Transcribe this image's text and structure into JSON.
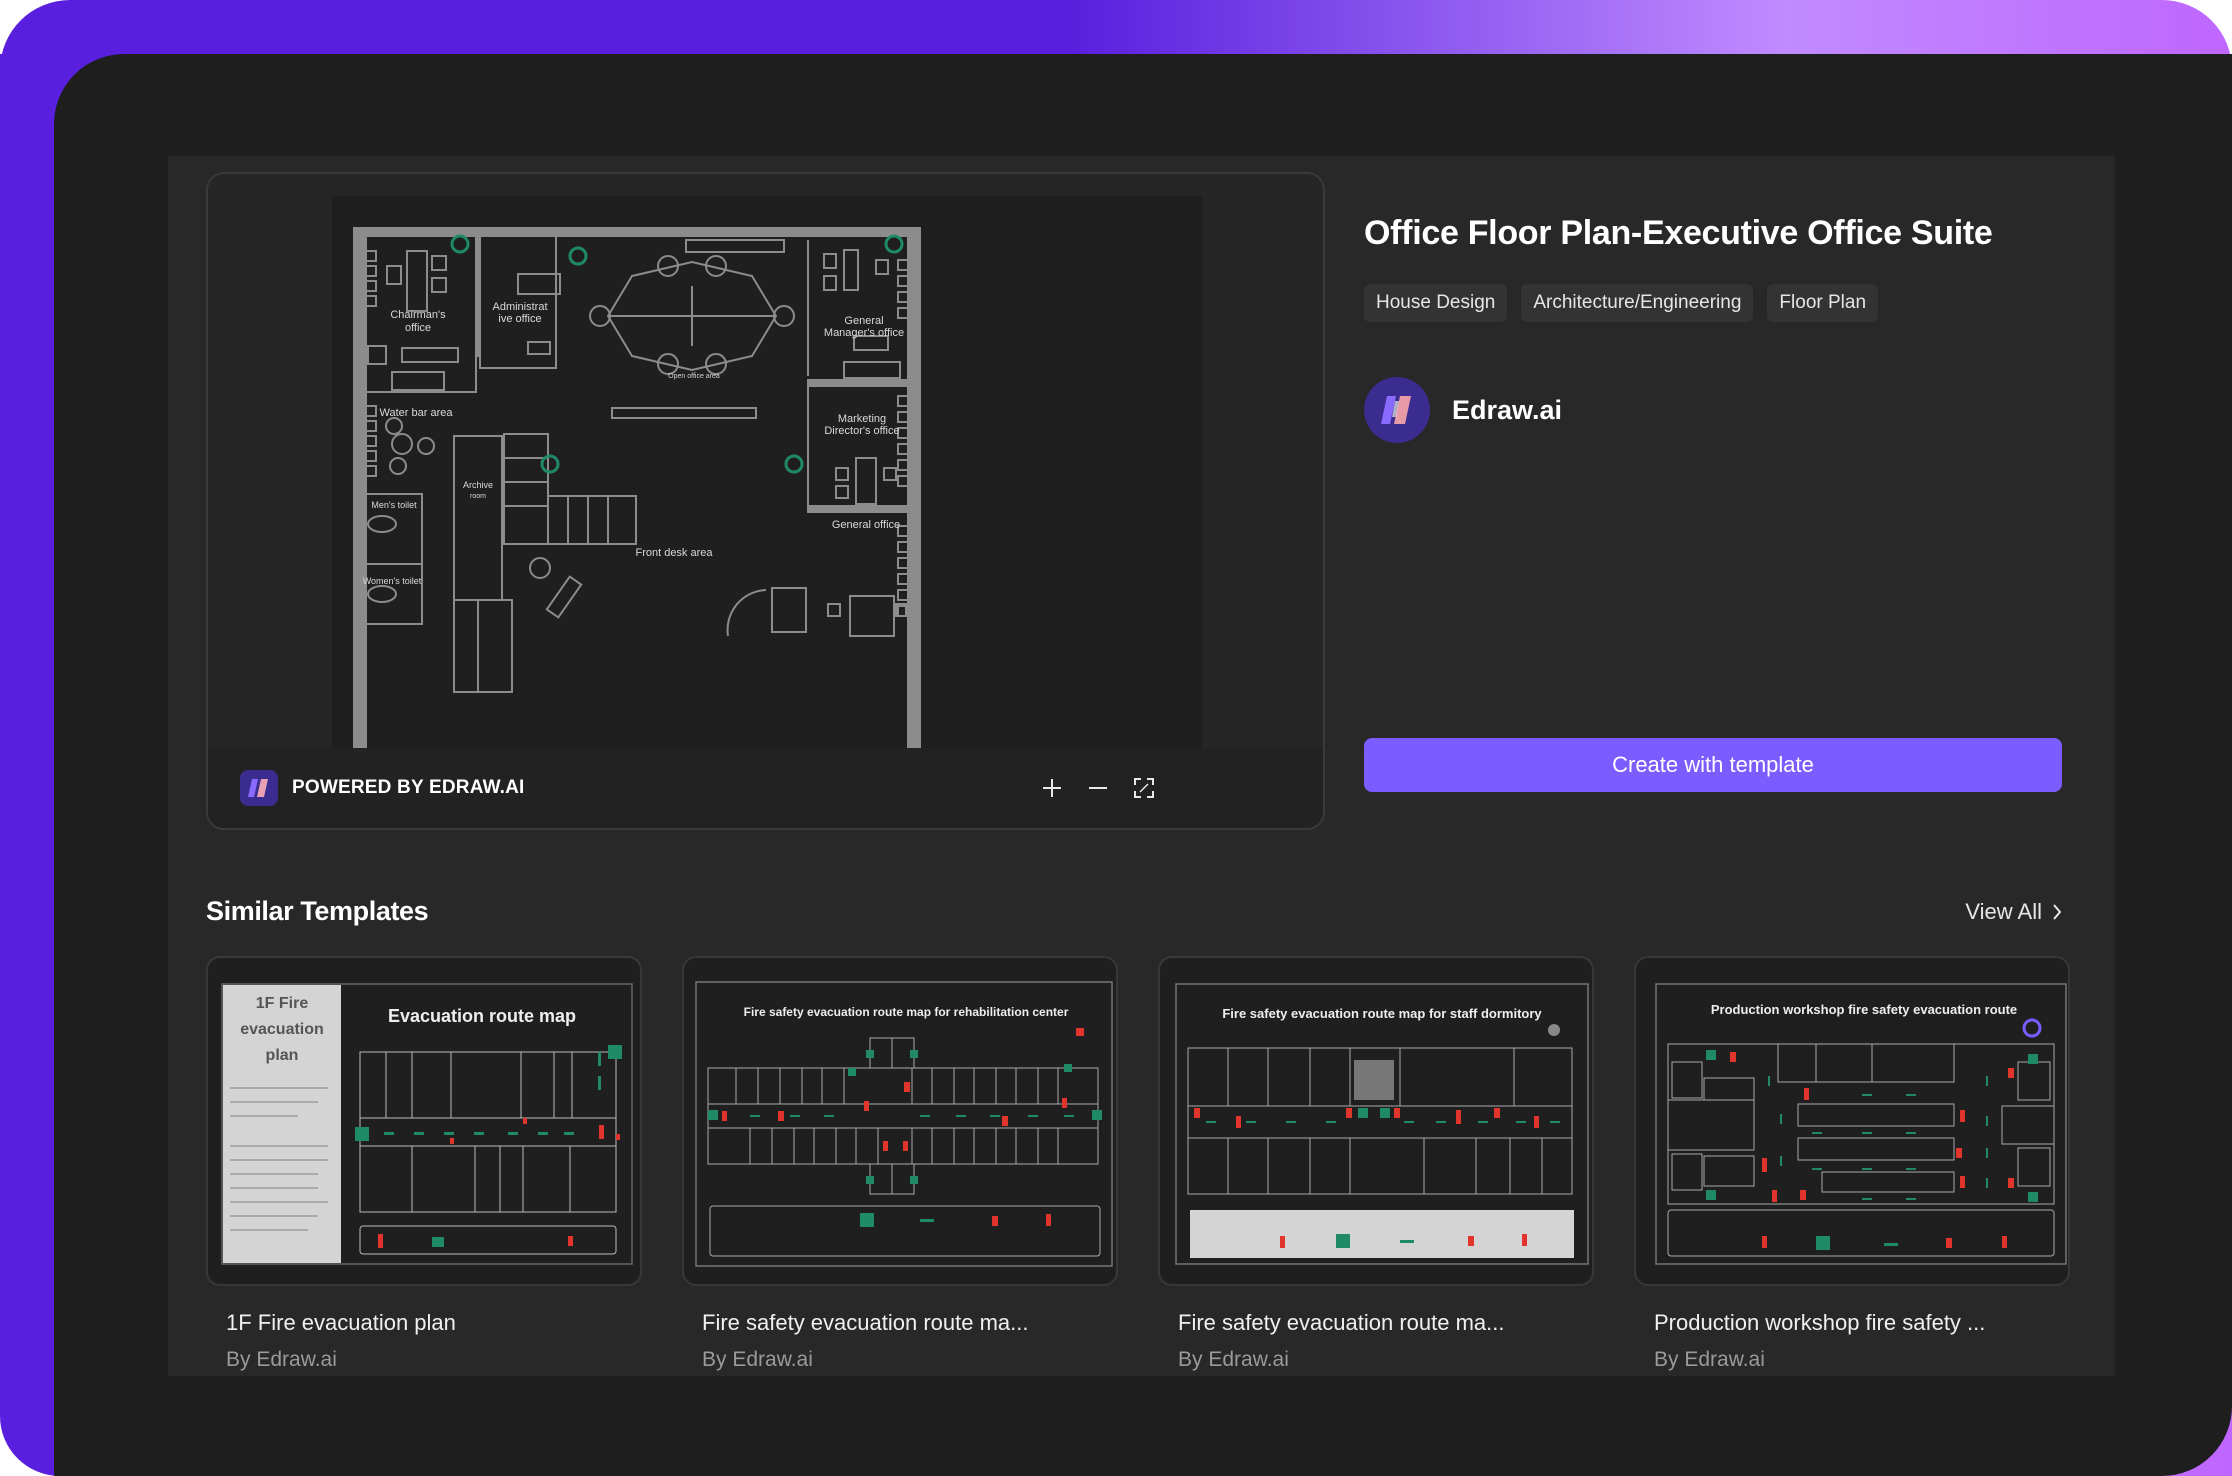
{
  "template": {
    "title": "Office Floor Plan-Executive Office Suite",
    "tags": [
      "House Design",
      "Architecture/Engineering",
      "Floor Plan"
    ],
    "author": "Edraw.ai",
    "create_button_label": "Create with template"
  },
  "preview": {
    "powered_by_label": "POWERED BY EDRAW.AI",
    "zoom_in_icon": "plus-icon",
    "zoom_out_icon": "minus-icon",
    "fullscreen_icon": "expand-icon",
    "floor_plan_labels": {
      "chairman": [
        "Chairman's",
        "office"
      ],
      "admin": [
        "Administrat",
        "ive office"
      ],
      "open_office": "Open office area",
      "general_manager": [
        "General",
        "Manager's office"
      ],
      "water_bar": "Water bar area",
      "archive": [
        "Archive",
        "room"
      ],
      "mens_toilet": "Men's toilet",
      "womens_toilet": "Women's toilet",
      "marketing": [
        "Marketing",
        "Director's office"
      ],
      "general_office": "General office",
      "front_desk": "Front desk area"
    }
  },
  "similar": {
    "heading": "Similar Templates",
    "view_all_label": "View All",
    "cards": [
      {
        "title": "1F Fire evacuation plan",
        "author": "By Edraw.ai",
        "thumb_heading": "Evacuation route map",
        "thumb_side": [
          "1F Fire",
          "evacuation",
          "plan"
        ]
      },
      {
        "title": "Fire safety evacuation route ma...",
        "author": "By Edraw.ai",
        "thumb_heading": "Fire safety evacuation route map for rehabilitation center"
      },
      {
        "title": "Fire safety evacuation route ma...",
        "author": "By Edraw.ai",
        "thumb_heading": "Fire safety evacuation route map for staff dormitory"
      },
      {
        "title": "Production workshop fire safety ...",
        "author": "By Edraw.ai",
        "thumb_heading": "Production workshop fire safety evacuation route"
      }
    ]
  },
  "colors": {
    "accent": "#7b5cff",
    "frame_start": "#5a1fde",
    "frame_end": "#bf66ff",
    "background": "#1e1e1e",
    "panel": "#282828",
    "plant_green": "#1f8a6a",
    "exit_green": "#1e8a66",
    "fire_red": "#e0342c"
  }
}
